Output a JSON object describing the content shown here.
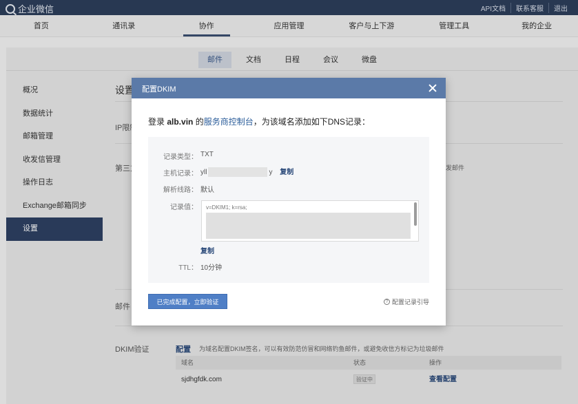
{
  "topbar": {
    "logo": "企业微信",
    "links": [
      "API文档",
      "联系客服",
      "退出"
    ]
  },
  "mainnav": {
    "items": [
      "首页",
      "通讯录",
      "协作",
      "应用管理",
      "客户与上下游",
      "管理工具",
      "我的企业"
    ],
    "active_index": 2
  },
  "subtabs": {
    "items": [
      "邮件",
      "文档",
      "日程",
      "会议",
      "微盘"
    ],
    "active_index": 0
  },
  "sidebar": {
    "items": [
      "概况",
      "数据统计",
      "邮箱管理",
      "收发信管理",
      "操作日志",
      "Exchange邮箱同步",
      "设置"
    ],
    "active_index": 6
  },
  "content": {
    "title": "设置",
    "ip_label": "IP限制",
    "third_label": "第三方",
    "third_suffix": "发邮件",
    "mail_label": "邮件",
    "dkim_label": "DKIM验证",
    "dkim_link": "配置",
    "dkim_desc": "为域名配置DKIM签名，可以有效防范仿冒和网络钓鱼邮件，或避免收信方标记为垃圾邮件",
    "table": {
      "headers": [
        "域名",
        "状态",
        "操作"
      ],
      "row": {
        "domain": "sjdhgfdk.com",
        "status": "验证中",
        "action": "查看配置"
      }
    }
  },
  "modal": {
    "title": "配置DKIM",
    "instruction_prefix": "登录 ",
    "instruction_domain": "alb.vin",
    "instruction_mid": " 的",
    "instruction_link": "服务商控制台",
    "instruction_suffix": "，为该域名添加如下DNS记录：",
    "fields": {
      "type_label": "记录类型：",
      "type_value": "TXT",
      "host_label": "主机记录：",
      "host_prefix": "yll",
      "host_suffix": "y",
      "line_label": "解析线路：",
      "line_value": "默认",
      "value_label": "记录值：",
      "value_text": "v=DKIM1; k=rsa;",
      "ttl_label": "TTL：",
      "ttl_value": "10分钟"
    },
    "copy_label": "复制",
    "primary_button": "已完成配置，立即验证",
    "guide_icon": "?",
    "guide_link": "配置记录引导"
  }
}
